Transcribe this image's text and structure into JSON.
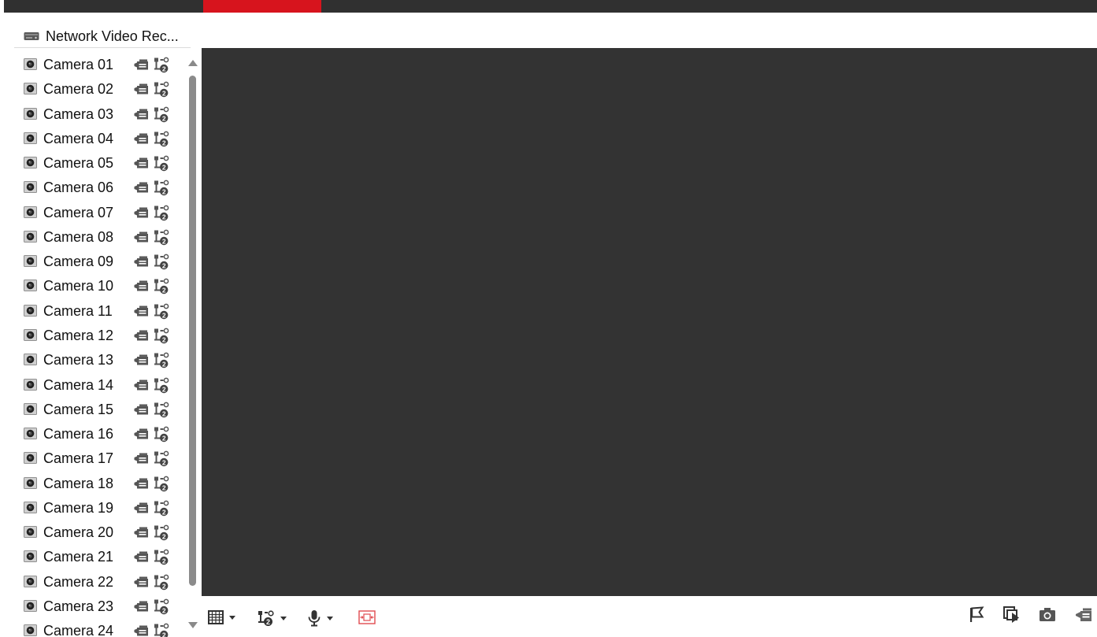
{
  "device": {
    "name": "Network Video Rec..."
  },
  "cameras": [
    "Camera 01",
    "Camera 02",
    "Camera 03",
    "Camera 04",
    "Camera 05",
    "Camera 06",
    "Camera 07",
    "Camera 08",
    "Camera 09",
    "Camera 10",
    "Camera 11",
    "Camera 12",
    "Camera 13",
    "Camera 14",
    "Camera 15",
    "Camera 16",
    "Camera 17",
    "Camera 18",
    "Camera 19",
    "Camera 20",
    "Camera 21",
    "Camera 22",
    "Camera 23",
    "Camera 24"
  ],
  "icons": {
    "device": "nvr-device-icon",
    "camera": "camera-icon",
    "record": "record-icon",
    "stream": "stream-icon",
    "layout": "window-layout-icon",
    "stream_select": "stream-select-icon",
    "audio": "microphone-icon",
    "fit": "fit-to-window-icon",
    "stop_all": "stop-all-flag-icon",
    "next": "next-page-icon",
    "capture": "capture-camera-icon",
    "record_all": "record-all-icon"
  },
  "colors": {
    "accent": "#d7141d",
    "topbar": "#303030",
    "video_bg": "#333333",
    "icon": "#555555"
  }
}
